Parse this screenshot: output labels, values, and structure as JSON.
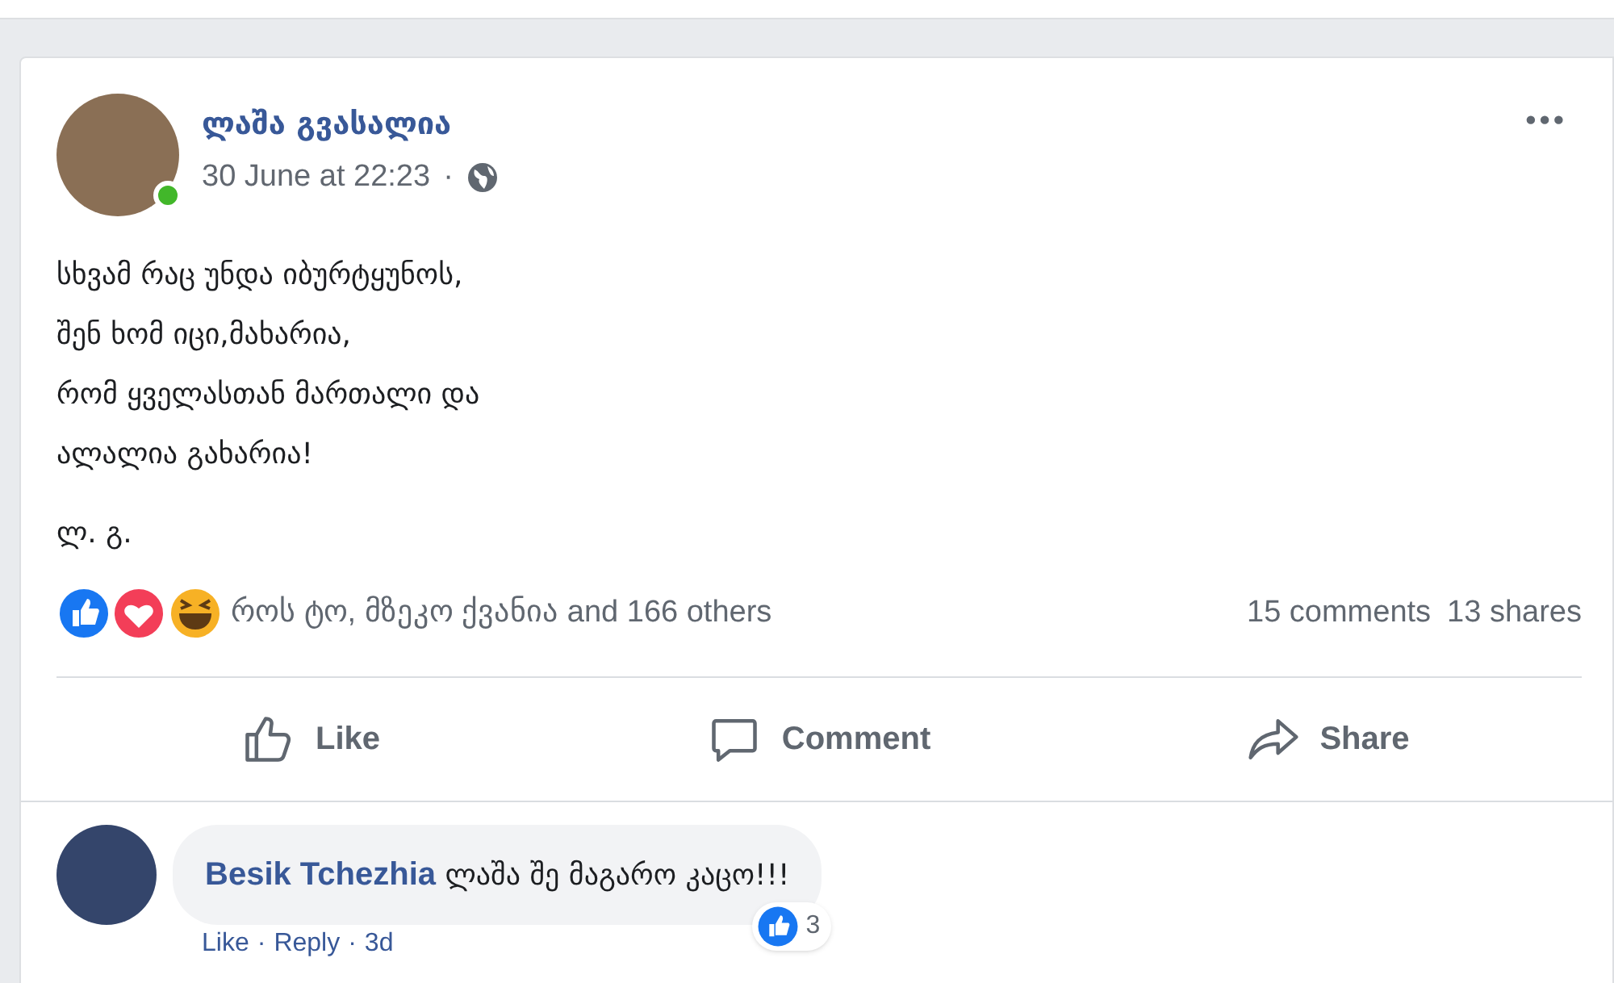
{
  "post": {
    "author": "ლაშა გვასალია",
    "online": true,
    "time": "30 June at 22:23",
    "separator": "·",
    "menu": "•••",
    "lines": [
      "სხვამ რაც უნდა იბურტყუნოს,",
      "შენ ხომ იცი,მახარია,",
      "რომ ყველასთან მართალი და",
      "ალალია გახარია!"
    ],
    "signature": "ლ. გ.",
    "reactions": {
      "summary": "როს ტო, მზეკო ქვანია and 166 others",
      "comments": "15 comments",
      "shares": "13 shares"
    },
    "actions": [
      {
        "kind": "like",
        "label": "Like"
      },
      {
        "kind": "comment",
        "label": "Comment"
      },
      {
        "kind": "share",
        "label": "Share"
      }
    ]
  },
  "comment": {
    "author": "Besik Tchezhia",
    "text": "ლაშა შე მაგარო კაცო!!!",
    "likes": "3",
    "links": [
      "Like",
      "·",
      "Reply",
      "·",
      "3d"
    ]
  }
}
